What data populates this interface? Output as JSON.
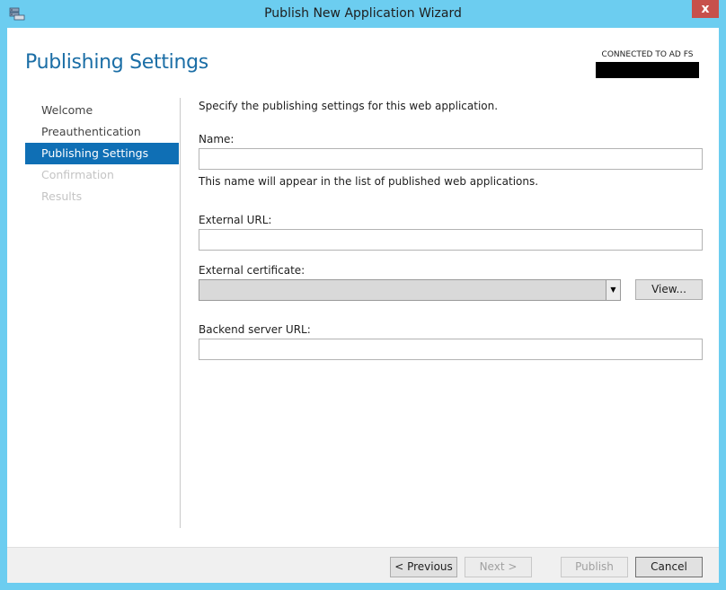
{
  "window": {
    "title": "Publish New Application Wizard",
    "close_glyph": "x"
  },
  "header": {
    "page_title": "Publishing Settings",
    "server_status": "CONNECTED TO AD FS"
  },
  "nav": {
    "items": [
      {
        "label": "Welcome",
        "state": "normal"
      },
      {
        "label": "Preauthentication",
        "state": "normal"
      },
      {
        "label": "Publishing Settings",
        "state": "selected"
      },
      {
        "label": "Confirmation",
        "state": "disabled"
      },
      {
        "label": "Results",
        "state": "disabled"
      }
    ]
  },
  "form": {
    "intro": "Specify the publishing settings for this web application.",
    "name": {
      "label": "Name:",
      "value": "",
      "hint": "This name will appear in the list of published web applications."
    },
    "external_url": {
      "label": "External URL:",
      "value": ""
    },
    "external_certificate": {
      "label": "External certificate:",
      "selected": "",
      "view_button": "View..."
    },
    "backend_url": {
      "label": "Backend server URL:",
      "value": ""
    }
  },
  "footer": {
    "previous": "< Previous",
    "next": "Next >",
    "publish": "Publish",
    "cancel": "Cancel"
  },
  "colors": {
    "frame": "#6ccdf0",
    "accent": "#0f6fb5",
    "title_blue": "#1b6ea6",
    "close": "#c7504b"
  }
}
